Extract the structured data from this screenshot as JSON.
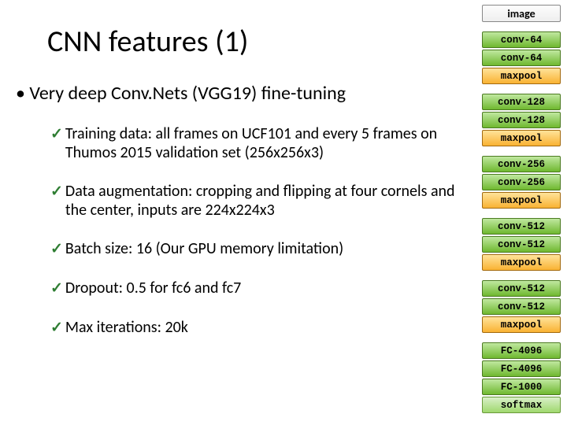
{
  "title": "CNN features (1)",
  "main_bullet": "Very deep Conv.Nets (VGG19) fine-tuning",
  "points": {
    "p0": "Training data: all frames on UCF101 and every 5 frames on Thumos 2015 validation set (256x256x3)",
    "p1": "Data augmentation:  cropping and flipping at four cornels and the center, inputs are 224x224x3",
    "p2": "Batch size: 16 (Our GPU memory limitation)",
    "p3": "Dropout: 0.5 for fc6 and fc7",
    "p4": "Max iterations: 20k"
  },
  "arch": {
    "image": "image",
    "g0": {
      "l0": "conv-64",
      "l1": "conv-64",
      "pool": "maxpool"
    },
    "g1": {
      "l0": "conv-128",
      "l1": "conv-128",
      "pool": "maxpool"
    },
    "g2": {
      "l0": "conv-256",
      "l1": "conv-256",
      "pool": "maxpool"
    },
    "g3": {
      "l0": "conv-512",
      "l1": "conv-512",
      "pool": "maxpool"
    },
    "g4": {
      "l0": "conv-512",
      "l1": "conv-512",
      "pool": "maxpool"
    },
    "fc": {
      "l0": "FC-4096",
      "l1": "FC-4096",
      "l2": "FC-1000",
      "soft": "softmax"
    }
  }
}
